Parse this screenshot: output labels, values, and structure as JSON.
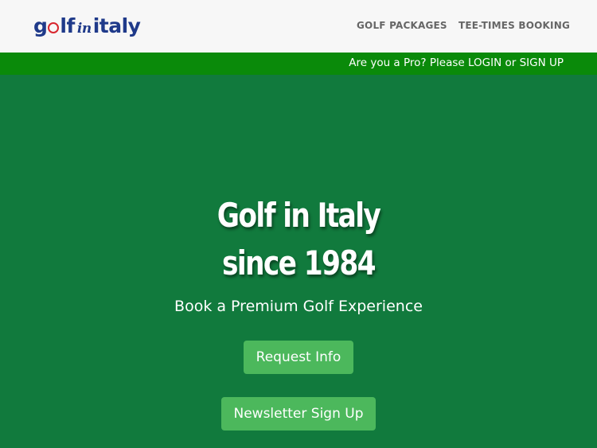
{
  "header": {
    "logo": {
      "part1": "g",
      "part2": "lf",
      "part3": "in",
      "part4": "italy"
    },
    "nav": [
      {
        "label": "GOLF PACKAGES"
      },
      {
        "label": "TEE-TIMES BOOKING"
      }
    ]
  },
  "pro_bar": {
    "text": "Are you a Pro? Please LOGIN or SIGN UP"
  },
  "hero": {
    "title_line1": "Golf in Italy",
    "title_line2": "since 1984",
    "subtitle": "Book a Premium Golf Experience",
    "request_button": "Request Info",
    "newsletter_button": "Newsletter Sign Up"
  },
  "colors": {
    "header_bg": "#f7f7f7",
    "pro_bar_bg": "#0a8a0a",
    "hero_bg": "#117a3d",
    "button_bg": "#4cb85c",
    "logo_blue": "#1f3a8a",
    "logo_red": "#d8262e"
  }
}
